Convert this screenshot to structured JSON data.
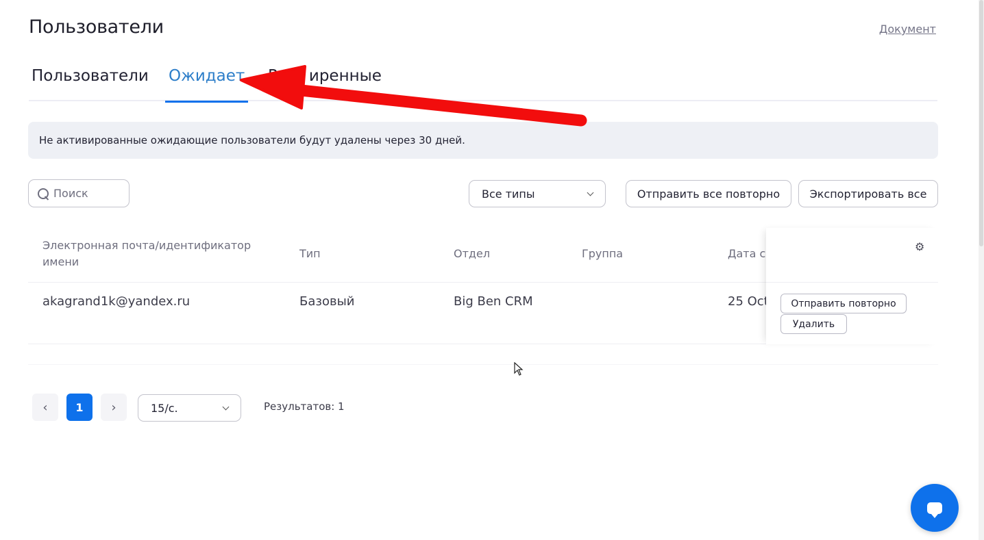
{
  "page": {
    "title": "Пользователи",
    "doc_link": "Документ"
  },
  "tabs": [
    {
      "label": "Пользователи",
      "active": false
    },
    {
      "label": "Ожидает",
      "active": true
    },
    {
      "label": "Расширенные",
      "visible_text": "Р  иренные",
      "active": false
    }
  ],
  "notice": "Не активированные ожидающие пользователи будут удалены через 30 дней.",
  "toolbar": {
    "search_placeholder": "Поиск",
    "type_filter": "Все типы",
    "resend_all": "Отправить все повторно",
    "export_all": "Экспортировать все"
  },
  "table": {
    "columns": [
      "Электронная почта/идентификатор имени",
      "Тип",
      "Отдел",
      "Группа",
      "Дата со"
    ],
    "rows": [
      {
        "email": "akagrand1k@yandex.ru",
        "type": "Базовый",
        "department": "Big Ben CRM",
        "group": "",
        "date": "25 Oct",
        "actions": {
          "resend": "Отправить повторно",
          "delete": "Удалить"
        }
      }
    ]
  },
  "pagination": {
    "prev": "‹",
    "current_page": "1",
    "next": "›",
    "page_size": "15/с.",
    "results": "Результатов: 1"
  },
  "colors": {
    "accent": "#0e71eb",
    "active_tab_text": "#2d7ec9",
    "annotation_arrow": "#f20d0d"
  },
  "icons": [
    "search-icon",
    "chevron-down-icon",
    "gear-icon",
    "chevron-left-icon",
    "chevron-right-icon",
    "chat-icon",
    "cursor-icon"
  ]
}
